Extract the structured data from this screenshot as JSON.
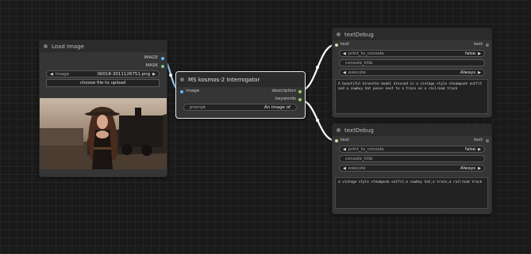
{
  "colors": {
    "image": "#64b5f6",
    "mask": "#81c784",
    "string": "#9ccc65",
    "text": "#c5e1a5",
    "canvas": "#1a1a1a",
    "node": "#353535"
  },
  "load_image": {
    "title": "Load Image",
    "outputs": {
      "image": "IMAGE",
      "mask": "MASK"
    },
    "widget": {
      "label": "image",
      "value": "00018-3011126751.png"
    },
    "upload_button": "choose file to upload"
  },
  "kosmos": {
    "title": "MS kosmos-2 Interrogator",
    "input": "image",
    "outputs": {
      "description": "description",
      "keywords": "keywords"
    },
    "prompt": {
      "label": "prompt",
      "value": "An image of"
    }
  },
  "debug1": {
    "title": "textDebug",
    "input": "text",
    "output": "text",
    "print": {
      "label": "print_to_console",
      "value": "false"
    },
    "console_title": "console_title",
    "execute": {
      "label": "execute",
      "value": "Always"
    },
    "text": "A beautiful brunette model dressed in a vintage style steampunk outfit and a cowboy hat poses next to a train on a railroad track"
  },
  "debug2": {
    "title": "textDebug",
    "input": "text",
    "output": "text",
    "print": {
      "label": "print_to_console",
      "value": "false"
    },
    "console_title": "console_title",
    "execute": {
      "label": "execute",
      "value": "Always"
    },
    "text": "a vintage style steampunk outfit,a cowboy hat,a train,a railroad track"
  }
}
